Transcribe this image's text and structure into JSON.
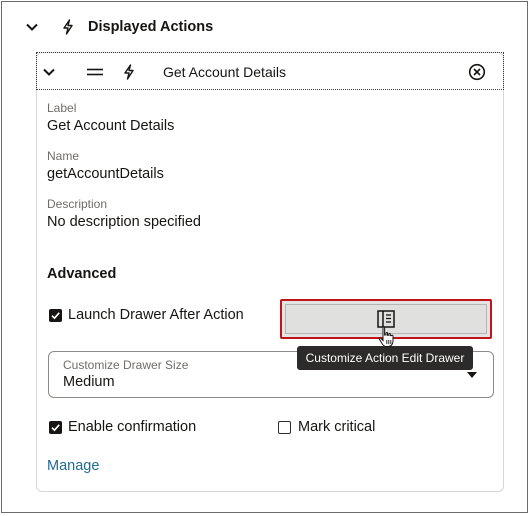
{
  "section": {
    "title": "Displayed Actions",
    "icons": {
      "expand": "chevron-down-icon",
      "lightning": "lightning-icon"
    }
  },
  "action": {
    "title": "Get Account Details",
    "icons": {
      "collapse": "chevron-down-icon",
      "drag": "drag-handle-icon",
      "type": "lightning-icon",
      "remove": "close-circle-icon"
    },
    "fields": {
      "label": {
        "label": "Label",
        "value": "Get Account Details"
      },
      "name": {
        "label": "Name",
        "value": "getAccountDetails"
      },
      "description": {
        "label": "Description",
        "value": "No description specified"
      }
    },
    "advanced": {
      "heading": "Advanced",
      "launch_drawer": {
        "label": "Launch Drawer After Action",
        "checked": true
      },
      "customize_button_icon": "edit-drawer-icon",
      "tooltip": "Customize Action Edit Drawer",
      "drawer_size": {
        "label": "Customize Drawer Size",
        "value": "Medium"
      },
      "enable_confirmation": {
        "label": "Enable confirmation",
        "checked": true
      },
      "mark_critical": {
        "label": "Mark critical",
        "checked": false
      },
      "manage_link": "Manage"
    }
  },
  "colors": {
    "highlight": "#c0141b",
    "link": "#1f6b94",
    "tooltip_bg": "#2d2b29"
  }
}
